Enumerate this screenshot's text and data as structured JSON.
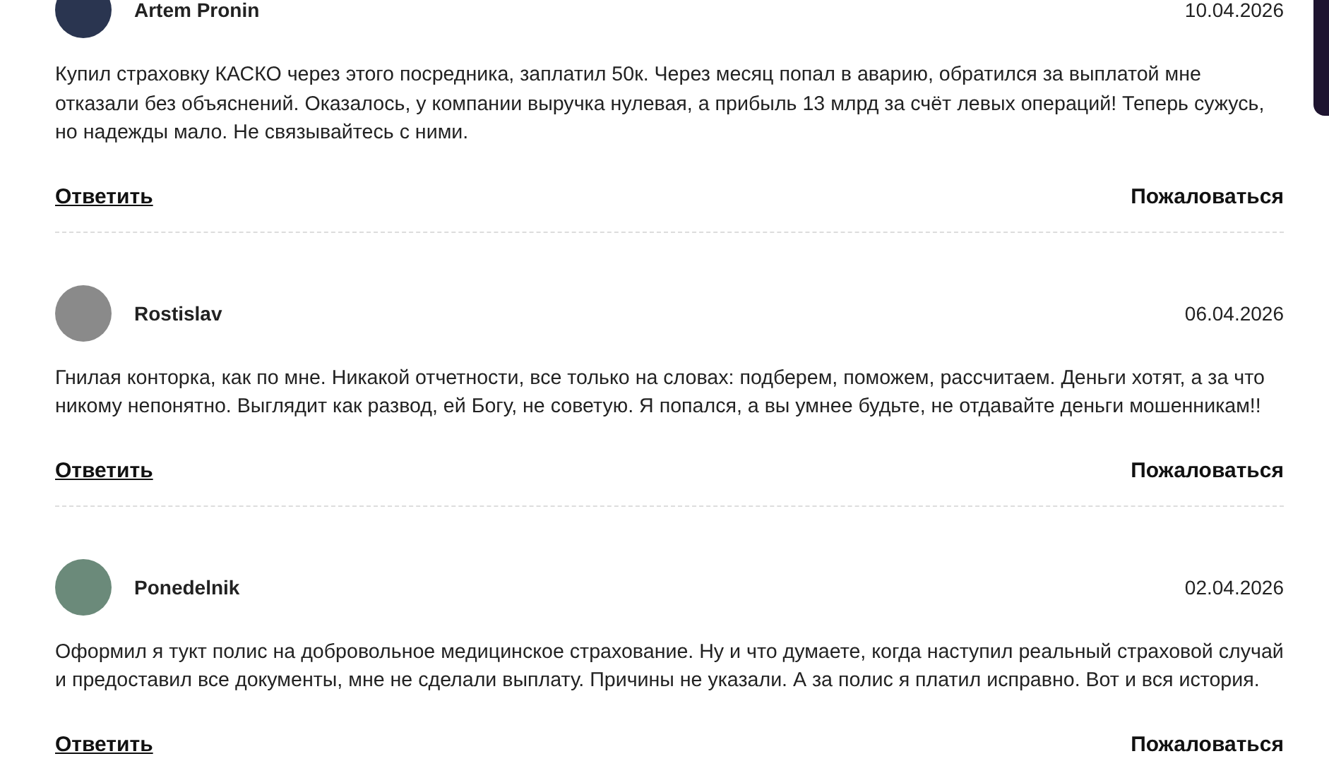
{
  "comments": [
    {
      "author": "Artem Pronin",
      "date": "10.04.2026",
      "text": "Купил страховку КАСКО через этого посредника, заплатил 50к. Через месяц попал в аварию, обратился за выплатой мне отказали без объяснений. Оказалось, у компании выручка нулевая, а прибыль 13 млрд за счёт левых операций! Теперь сужусь, но надежды мало. Не связывайтесь с ними.",
      "reply": "Ответить",
      "report": "Пожаловаться"
    },
    {
      "author": "Rostislav",
      "date": "06.04.2026",
      "text": "Гнилая конторка, как по мне. Никакой отчетности, все только на словах: подберем, поможем, рассчитаем. Деньги хотят, а за что никому непонятно. Выглядит как развод, ей Богу, не советую. Я попался, а вы умнее будьте, не отдавайте деньги мошенникам!!",
      "reply": "Ответить",
      "report": "Пожаловаться"
    },
    {
      "author": "Ponedelnik",
      "date": "02.04.2026",
      "text": "Оформил я тукт полис на добровольное медицинское страхование. Ну и что думаете, когда наступил реальный страховой случай и предоставил все документы, мне не сделали выплату. Причины не указали. А за полис я платил исправно. Вот и вся история.",
      "reply": "Ответить",
      "report": "Пожаловаться"
    }
  ]
}
